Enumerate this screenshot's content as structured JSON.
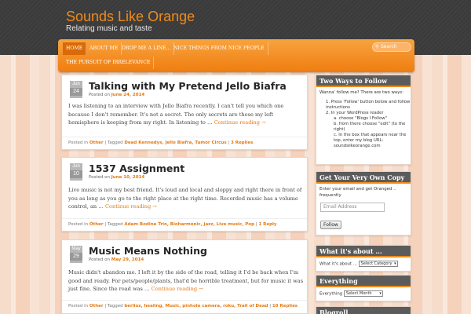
{
  "site": {
    "title": "Sounds Like Orange",
    "description": "Relating music and taste"
  },
  "nav": {
    "items": [
      "Home",
      "About Me",
      "Drop me a line...",
      "Nice things from nice people",
      "The Pursuit of Irrelevance"
    ],
    "search_placeholder": "Search"
  },
  "posts": [
    {
      "month": "Jun",
      "day": "24",
      "title": "Talking with My Pretend Jello Biafra",
      "posted_label": "Posted on",
      "date": "June 24, 2014",
      "excerpt": "I was listening to an interview with Jello Biafra recently. I can't tell you which one because I don't remember. It's not a secret. The only secrets are those my left hemisphere is keeping from my right. In listening to …",
      "more": "Continue reading →",
      "posted_in_label": "Posted in",
      "category": "Other",
      "tagged_label": "| Tagged",
      "tags": "Dead Kennedys, Jello Biafra, Tumor Circus",
      "replies": "3 Replies"
    },
    {
      "month": "Jun",
      "day": "10",
      "title": "1537 Assignment",
      "posted_label": "Posted on",
      "date": "June 10, 2014",
      "excerpt": "Live music is not my best friend. It's loud and local and sloppy and right there in front of you as long as you go to the right place at the right time. Recorded music has a volume control, an …",
      "more": "Continue reading →",
      "posted_in_label": "Posted in",
      "category": "Other",
      "tagged_label": "| Tagged",
      "tags": "Adam Bodine Trio, Bioharmonic, jazz, Live music, Pop",
      "replies": "1 Reply"
    },
    {
      "month": "May",
      "day": "29",
      "title": "Music Means Nothing",
      "posted_label": "Posted on",
      "date": "May 29, 2014",
      "excerpt": "Music didn't abandon me. I left it by the side of the road, telling it I'd be back when I'm good and ready. For pets/people/plants, that'd be horrible treatment, but for music it was just fine. Since the road was …",
      "more": "Continue reading →",
      "posted_in_label": "Posted in",
      "category": "Other",
      "tagged_label": "| Tagged",
      "tags": "berlioz, healing, Music, pinhole camera, roku, Trail of Dead",
      "replies": "10 Replies"
    }
  ],
  "sidebar": {
    "follow": {
      "title": "Two Ways to Follow",
      "intro": "Wanna' follow me? There are two ways:",
      "step1": "Press 'Follow' button below and follow instructions",
      "step2": "In your WordPress reader",
      "sub_a": "choose \"Blogs I Follow\"",
      "sub_b": "from there choose \"edit\" (to the right)",
      "sub_c": "In the box that appears near the top, enter my blog URL: soundslikeorange.com"
    },
    "copy": {
      "title": "Get Your Very Own Copy",
      "text": "Enter your email and get Oranged .. frequently",
      "email_placeholder": "Email Address",
      "button": "Follow"
    },
    "about": {
      "title": "What it's about ...",
      "label": "What it's about ...",
      "select": "Select Category"
    },
    "everything": {
      "title": "Everything",
      "label": "Everything",
      "select": "Select Month"
    },
    "blogroll": {
      "title": "Blogroll"
    }
  },
  "colors": {
    "accent": "#f08a1c",
    "header_bg": "#3c3c3c",
    "page_bg": "#f6dccb"
  }
}
